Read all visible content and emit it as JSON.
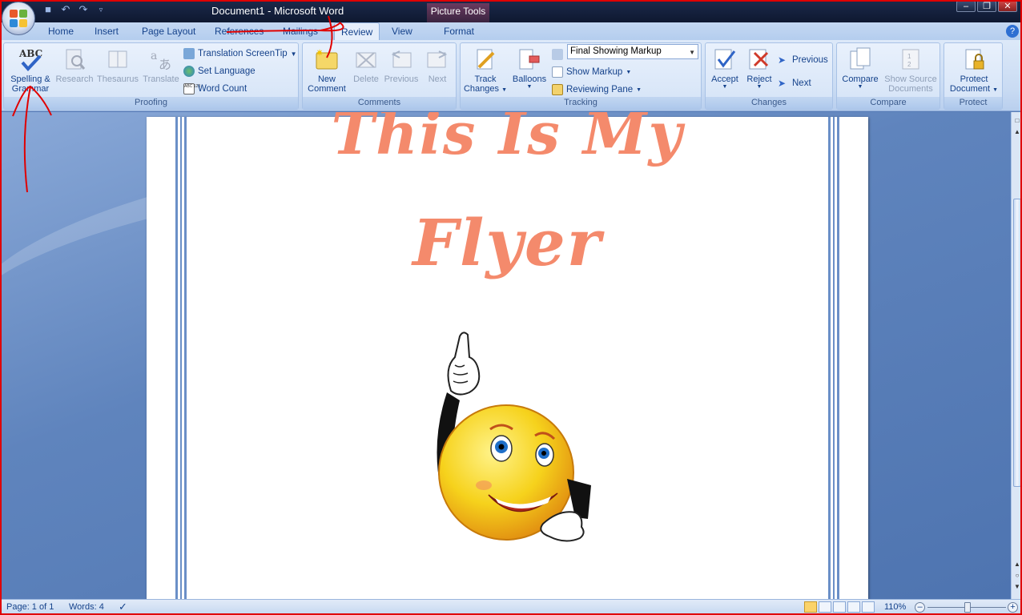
{
  "window": {
    "title": "Document1 - Microsoft Word",
    "context_tab": "Picture Tools",
    "controls": [
      "minimize",
      "restore",
      "close"
    ]
  },
  "quick_access": [
    "save-icon",
    "undo-icon",
    "redo-icon",
    "customize-icon"
  ],
  "tabs": [
    {
      "label": "Home"
    },
    {
      "label": "Insert"
    },
    {
      "label": "Page Layout"
    },
    {
      "label": "References"
    },
    {
      "label": "Mailings"
    },
    {
      "label": "Review",
      "active": true
    },
    {
      "label": "View"
    },
    {
      "label": "Format"
    }
  ],
  "ribbon": {
    "proofing": {
      "label": "Proofing",
      "spelling": {
        "line1": "Spelling &",
        "line2": "Grammar",
        "icon_text": "ABC"
      },
      "research": "Research",
      "thesaurus": "Thesaurus",
      "translate": "Translate",
      "translation_screentip": "Translation ScreenTip",
      "set_language": "Set Language",
      "word_count": "Word Count",
      "word_count_icon_text": "ABC 123"
    },
    "comments": {
      "label": "Comments",
      "new_comment": {
        "line1": "New",
        "line2": "Comment"
      },
      "delete": "Delete",
      "previous": "Previous",
      "next": "Next"
    },
    "tracking": {
      "label": "Tracking",
      "track_changes": {
        "line1": "Track",
        "line2": "Changes"
      },
      "balloons": "Balloons",
      "display_combo": "Final Showing Markup",
      "show_markup": "Show Markup",
      "reviewing_pane": "Reviewing Pane"
    },
    "changes": {
      "label": "Changes",
      "accept": "Accept",
      "reject": "Reject",
      "previous": "Previous",
      "next": "Next"
    },
    "compare": {
      "label": "Compare",
      "compare": "Compare",
      "show_source": {
        "line1": "Show Source",
        "line2": "Documents"
      }
    },
    "protect": {
      "label": "Protect",
      "protect_document": {
        "line1": "Protect",
        "line2": "Document"
      }
    }
  },
  "document": {
    "title_line1": "This Is My",
    "title_line2": "Flyer",
    "title_color": "#f48a6c"
  },
  "status": {
    "page": "Page: 1 of 1",
    "words": "Words: 4",
    "zoom": "110%"
  },
  "colors": {
    "annotation": "#e00000",
    "border_lines": "#6a8fc7"
  }
}
